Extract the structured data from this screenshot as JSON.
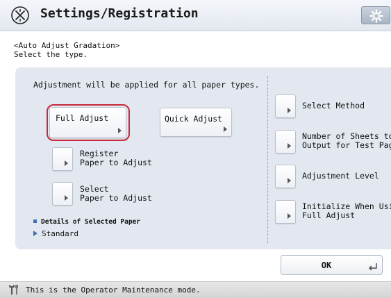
{
  "header": {
    "title": "Settings/Registration",
    "icon": "settings-registration-icon",
    "gear_button_icon": "gear-icon"
  },
  "prompt": {
    "line1": "<Auto Adjust Gradation>",
    "line2": "Select the type."
  },
  "info_text": "Adjustment will be applied for all paper types.",
  "left_buttons": {
    "full_adjust": "Full Adjust",
    "quick_adjust": "Quick Adjust",
    "register_paper": {
      "line1": "Register",
      "line2": "Paper to Adjust"
    },
    "select_paper": {
      "line1": "Select",
      "line2": "Paper to Adjust"
    }
  },
  "selected_item": "Full Adjust",
  "details": {
    "label": "Details of Selected Paper",
    "value": "Standard"
  },
  "right_buttons": {
    "select_method": "Select Method",
    "num_sheets": {
      "line1": "Number of Sheets to",
      "line2": "Output for Test Page"
    },
    "adjustment_level": "Adjustment Level",
    "initialize": {
      "line1": "Initialize When Using",
      "line2": "Full Adjust"
    }
  },
  "ok_button": {
    "label": "OK",
    "icon": "enter-icon"
  },
  "status_bar": {
    "icon": "wrench-icon",
    "text": "This is the Operator Maintenance mode."
  },
  "colors": {
    "highlight": "#c62a3a",
    "panel_bg": "#e3e8f0",
    "accent_blue": "#3c6fb6"
  }
}
